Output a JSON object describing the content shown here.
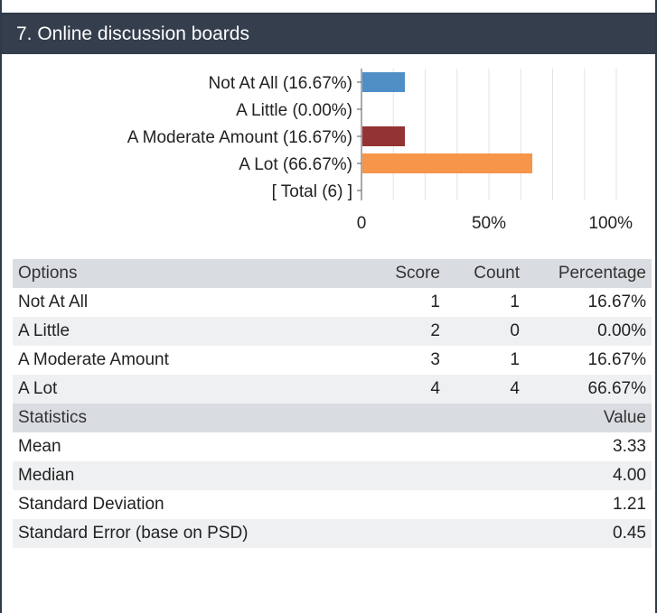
{
  "panel": {
    "title": "7. Online discussion boards"
  },
  "chart_data": {
    "type": "bar",
    "orientation": "horizontal",
    "categories": [
      "Not At All (16.67%)",
      "A Little (0.00%)",
      "A Moderate Amount (16.67%)",
      "A Lot (66.67%)",
      "[ Total (6) ]"
    ],
    "values": [
      16.67,
      0.0,
      16.67,
      66.67,
      null
    ],
    "colors": [
      "#4f8fc6",
      "#6fa7d8",
      "#943333",
      "#f7954a",
      null
    ],
    "xlim": [
      0,
      100
    ],
    "xticks": [
      "0",
      "50%",
      "100%"
    ],
    "grid": true
  },
  "table": {
    "headers": [
      "Options",
      "Score",
      "Count",
      "Percentage"
    ],
    "rows": [
      [
        "Not At All",
        "1",
        "1",
        "16.67%"
      ],
      [
        "A Little",
        "2",
        "0",
        "0.00%"
      ],
      [
        "A Moderate Amount",
        "3",
        "1",
        "16.67%"
      ],
      [
        "A Lot",
        "4",
        "4",
        "66.67%"
      ]
    ]
  },
  "statistics": {
    "headers": [
      "Statistics",
      "Value"
    ],
    "rows": [
      [
        "Mean",
        "3.33"
      ],
      [
        "Median",
        "4.00"
      ],
      [
        "Standard Deviation",
        "1.21"
      ],
      [
        "Standard Error (base on PSD)",
        "0.45"
      ]
    ]
  }
}
